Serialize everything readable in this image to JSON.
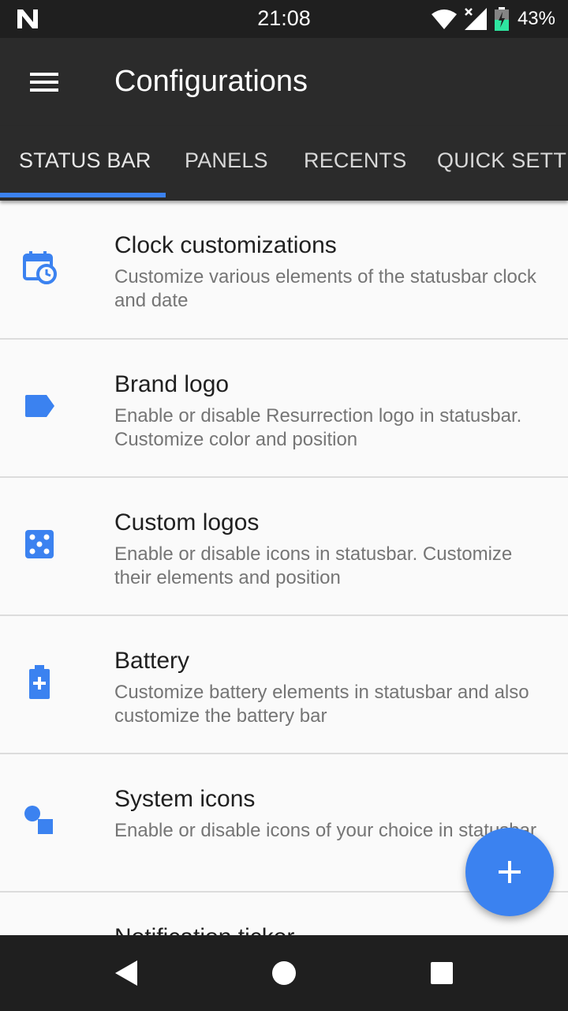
{
  "status_bar": {
    "time": "21:08",
    "battery_percent": "43%",
    "icons": [
      "n-logo-icon",
      "wifi-icon",
      "signal-icon",
      "battery-icon"
    ]
  },
  "app_bar": {
    "title": "Configurations",
    "menu_icon": "hamburger-menu-icon"
  },
  "tabs": [
    {
      "label": "STATUS BAR",
      "active": true
    },
    {
      "label": "PANELS",
      "active": false
    },
    {
      "label": "RECENTS",
      "active": false
    },
    {
      "label": "QUICK SETTI",
      "active": false
    }
  ],
  "items": [
    {
      "icon": "calendar-clock-icon",
      "title": "Clock customizations",
      "subtitle": "Customize various elements of the statusbar clock and date"
    },
    {
      "icon": "label-tag-icon",
      "title": "Brand logo",
      "subtitle": "Enable or disable Resurrection logo in statusbar. Customize color and position"
    },
    {
      "icon": "dice-icon",
      "title": "Custom logos",
      "subtitle": "Enable or disable icons in statusbar. Customize their elements and position"
    },
    {
      "icon": "battery-plus-icon",
      "title": "Battery",
      "subtitle": "Customize battery elements in statusbar and also customize the battery bar"
    },
    {
      "icon": "shapes-icon",
      "title": "System icons",
      "subtitle": "Enable or disable icons of your choice in statusbar"
    },
    {
      "icon": "ticker-icon",
      "title": "Notification ticker",
      "subtitle": ""
    }
  ],
  "fab": {
    "icon": "plus-icon"
  },
  "nav_bar": {
    "icons": [
      "back-icon",
      "home-icon",
      "recents-icon"
    ]
  },
  "colors": {
    "accent": "#3b82f0",
    "appbar": "#2b2b2b",
    "statusbar": "#1f1f1f"
  }
}
